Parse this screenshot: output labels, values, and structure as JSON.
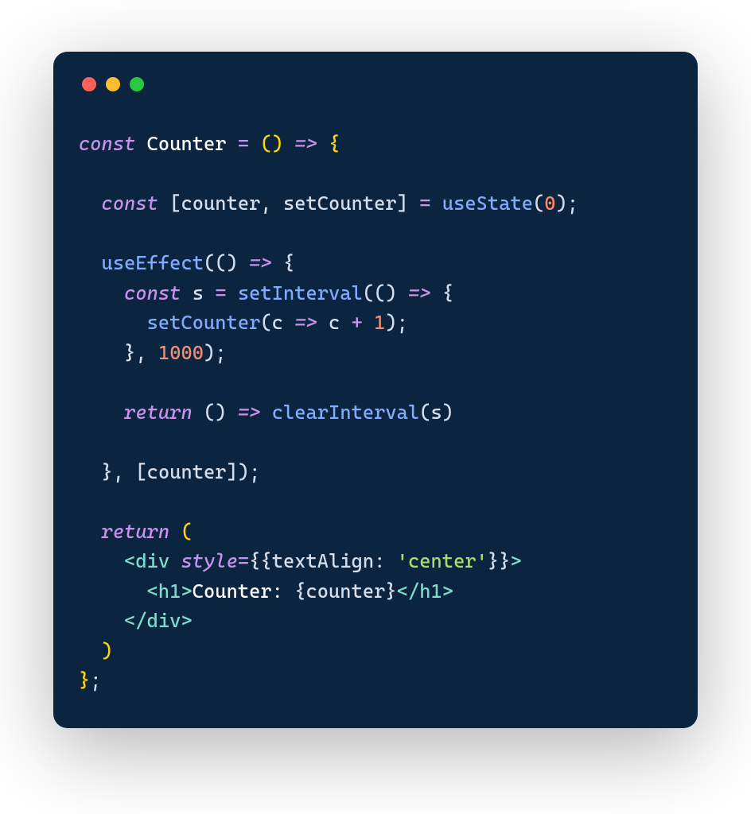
{
  "traffic": {
    "red": "#ff5f57",
    "yellow": "#febc2e",
    "green": "#28c840"
  },
  "code": {
    "t": {
      "const": "const",
      "Counter": "Counter",
      "eq": "=",
      "lp": "(",
      "rp": ")",
      "sp": " ",
      "arrow": "=>",
      "lb": "{",
      "rb": "}",
      "lbr": "[",
      "rbr": "]",
      "comma": ",",
      "semi": ";",
      "counter": "counter",
      "setCounter": "setCounter",
      "useState": "useState",
      "zero": "0",
      "useEffect": "useEffect",
      "s": "s",
      "setInterval": "setInterval",
      "c": "c",
      "plus": "+",
      "one": "1",
      "thousand": "1000",
      "return": "return",
      "clearInterval": "clearInterval",
      "lt": "<",
      "gt": ">",
      "ltSlash": "</",
      "div": "div",
      "h1": "h1",
      "style": "style",
      "textAlign": "textAlign",
      "colon": ":",
      "center": "'center'",
      "jsxText": "Counter: "
    }
  }
}
